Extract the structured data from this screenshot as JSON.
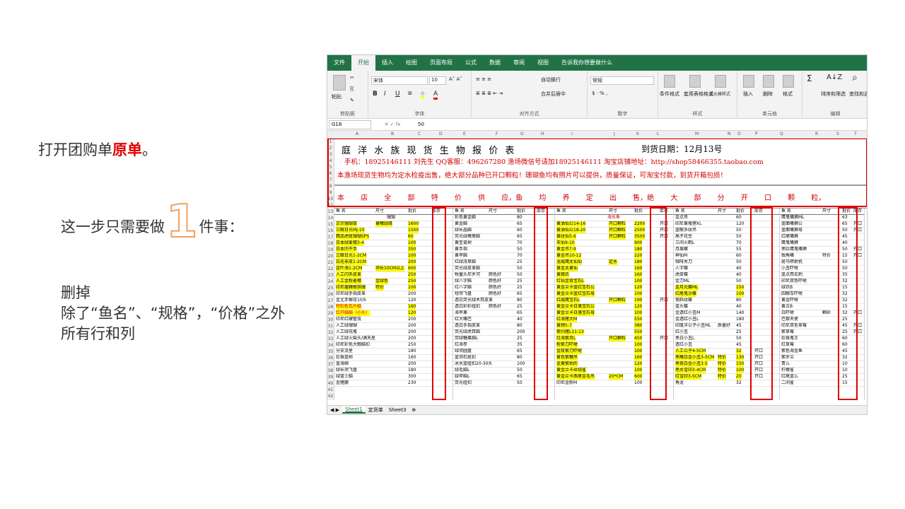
{
  "slide": {
    "step_text_prefix": "打开团购单",
    "step_text_highlight": "原单",
    "step_text_suffix": "。",
    "only_one_prefix": "这一步只需要做",
    "only_one_number": "1",
    "only_one_suffix": "件事：",
    "delete_title": "删掉",
    "delete_line2": "除了“鱼名”、“规格”，“价格”之外",
    "delete_line3": "所有行和列"
  },
  "excel": {
    "tabs": [
      "文件",
      "开始",
      "插入",
      "绘图",
      "页面布局",
      "公式",
      "数据",
      "审阅",
      "视图",
      "告诉我你想要做什么"
    ],
    "active_tab": "开始",
    "clipboard_label": "剪贴板",
    "paste_label": "粘贴",
    "font_label": "字体",
    "font_name": "宋体",
    "font_size": "10",
    "align_label": "对齐方式",
    "wrap_label": "自动换行",
    "merge_label": "合并后居中",
    "number_label": "数字",
    "number_format": "常规",
    "styles_label": "样式",
    "cond_format": "条件格式",
    "table_format": "套用表格格式",
    "cell_style": "单元格样式",
    "cells_label": "单元格",
    "insert": "插入",
    "delete": "删除",
    "format": "格式",
    "edit_label": "编辑",
    "sort_filter": "排序和筛选",
    "find_select": "查找和选",
    "namebox": "G18",
    "fx": "fx",
    "formula_value": "50",
    "columns": [
      "A",
      "B",
      "C",
      "D",
      "E",
      "F",
      "G",
      "H",
      "I",
      "J",
      "K",
      "L",
      "M",
      "N",
      "O",
      "P",
      "Q",
      "R",
      "S",
      "T"
    ],
    "title": "庭 洋 水 族 现 货 生 物 报 价 表",
    "date": "到货日期：12月13号",
    "contact": "手机：18925146111 刘先生      QQ客服：496267280 渔场微信号请加18925146111 淘宝店铺地址：http://shop58466355.taobao.com",
    "notice": "本渔场现货生物均为定水检疫出售，绝大部分品种已开口颗粒！珊瑚鱼均有照片可以提供，质量保证，可淘宝付款，到货开箱包损！",
    "sale_line": "本 店 全 部 特 价 供 应，鱼 均 养 定 出 售，绝 大 部 分 开 口 颗 粒，",
    "header": {
      "name": "鱼 名",
      "size": "尺寸",
      "price": "批价",
      "stock": "库存"
    },
    "sec1_title": "珊瑚",
    "sec2_title": "海水鱼",
    "sheets": [
      "Sheet1",
      "定货单",
      "Sheet3"
    ],
    "block1": [
      [
        "正宗珊瑚苗",
        "黄鳍绿缘",
        "1600"
      ],
      [
        "三眼日光MJ-10",
        "",
        "1500"
      ],
      [
        "精品虎斑珊瑚SPS",
        "",
        "60"
      ],
      [
        "日本绿麦穗3-4",
        "",
        "100"
      ],
      [
        "日本凹干手",
        "",
        "350"
      ],
      [
        "三眼日光1-2CM",
        "",
        "100"
      ],
      [
        "白花非皮1-2CM",
        "",
        "200"
      ],
      [
        "金叶海1-2CM",
        "须长10CM以上",
        "600"
      ],
      [
        "人工闪手皮革",
        "",
        "250"
      ],
      [
        "人工金粉麦穗",
        "金绿色",
        "250"
      ],
      [
        "印尼瘤棘根指珊",
        "特价",
        "100"
      ],
      [
        "印尼绿手指皮革",
        "",
        "200"
      ],
      [
        "金尤手椰花10头",
        "",
        "120"
      ],
      [
        "特别色瓦片脑",
        "",
        "160"
      ],
      [
        "红开脑脑（小头）",
        "",
        "120"
      ],
      [
        "印尼红硬管虫",
        "",
        "200"
      ],
      [
        "人工绿珊瑚",
        "",
        "200"
      ],
      [
        "人工绿花瓶",
        "",
        "200"
      ],
      [
        "人工绿火柴头/满天星",
        "",
        "200"
      ],
      [
        "印尼彩色大眼脑扣",
        "",
        "250"
      ],
      [
        "分支流星",
        "",
        "180"
      ],
      [
        "珍珠蓝树",
        "",
        "160"
      ],
      [
        "蓝海绵",
        "",
        "200"
      ],
      [
        "绿长须飞盘",
        "",
        "180"
      ],
      [
        "绿蓝士脑",
        "",
        "300"
      ],
      [
        "金猪骡",
        "",
        "230"
      ]
    ],
    "block2": [
      [
        "彩色黄金脑",
        "",
        "80"
      ],
      [
        "黄金脑",
        "",
        "65"
      ],
      [
        "绿长晶脑",
        "",
        "60"
      ],
      [
        "荧光绿棒尾脑",
        "",
        "65"
      ],
      [
        "黄圣诞树",
        "",
        "70"
      ],
      [
        "黄手指",
        "",
        "50"
      ],
      [
        "黄苹脑",
        "",
        "70"
      ],
      [
        "红绿茂草脑",
        "",
        "25"
      ],
      [
        "荧光绿皮革脑",
        "",
        "50"
      ],
      [
        "牧童头尼罗河",
        "颜色好",
        "50"
      ],
      [
        "绿八字脑",
        "颜色好",
        "25"
      ],
      [
        "红八字脑",
        "颜色好",
        "25"
      ],
      [
        "短须飞盘",
        "颜色好",
        "65"
      ],
      [
        "透白荧光绿木耳皮革",
        "",
        "80"
      ],
      [
        "透白彩彩纽扣",
        "颜色好",
        "25"
      ],
      [
        "海苹果",
        "",
        "65"
      ],
      [
        "红大嘴巴",
        "",
        "40"
      ],
      [
        "透白手指皮革",
        "",
        "80"
      ],
      [
        "荧光绿虎耳脑",
        "",
        "200"
      ],
      [
        "荧绿糖果脑L",
        "",
        "25"
      ],
      [
        "红海参",
        "",
        "35"
      ],
      [
        "绿须圆盘",
        "",
        "65"
      ],
      [
        "蓝须石斑扣",
        "",
        "80"
      ],
      [
        "冰水蓝纽扣20-30头",
        "",
        "100"
      ],
      [
        "绿毛脑L",
        "",
        "50"
      ],
      [
        "绿苹脑L",
        "",
        "65"
      ],
      [
        "荧光纽扣",
        "",
        "50"
      ]
    ],
    "block3": [
      [
        "黄油仙公14-16",
        "开口颗粒",
        "2200"
      ],
      [
        "黄油仙公18-20",
        "开口颗粒",
        "2500"
      ],
      [
        "黄纹仙5-6",
        "开口颗粒",
        "3500"
      ],
      [
        "天仙9-10",
        "",
        "900"
      ],
      [
        "黄金吊7-9",
        "",
        "180"
      ],
      [
        "黄金吊10-12",
        "",
        "220"
      ],
      [
        "龙威鹰太仙仙",
        "定水",
        "180"
      ],
      [
        "黄金太黄仙",
        "",
        "160"
      ],
      [
        "黄蜡衣",
        "",
        "160"
      ],
      [
        "红钻金背宝石L",
        "",
        "100"
      ],
      [
        "黄金兰卡蓝红宝石公",
        "",
        "120"
      ],
      [
        "黄金兰卡蓝红宝石母",
        "",
        "100"
      ],
      [
        "红威鹰宝石L",
        "开口颗粒",
        "190"
      ],
      [
        "黄金兰卡日落宝石公",
        "",
        "120"
      ],
      [
        "黄金兰卡日落宝石母",
        "",
        "100"
      ],
      [
        "红海猪大M",
        "",
        "550"
      ],
      [
        "黄颊5-7",
        "",
        "380"
      ],
      [
        "紫扫猪L11-13",
        "",
        "550"
      ],
      [
        "红海紫月L",
        "开口颗粒",
        "450"
      ],
      [
        "粉紫刀吓唬",
        "",
        "100"
      ],
      [
        "金玫紫刀吓唬",
        "",
        "100"
      ],
      [
        "黄色紫糖吊",
        "",
        "160"
      ],
      [
        "金黄紫枯的",
        "",
        "120"
      ],
      [
        "黄金兰卡丝绒雀",
        "",
        "100"
      ],
      [
        "黄金兰卡燕尾金毛吊",
        "20*CM",
        "600"
      ],
      [
        "印尼金粉M",
        "",
        "100"
      ]
    ],
    "block4": [
      [
        "金点吊",
        "",
        "60"
      ],
      [
        "印尼黄瓶狸XL",
        "",
        "120"
      ],
      [
        "蓝眼多纹吊",
        "",
        "50"
      ],
      [
        "高子花豆",
        "",
        "50"
      ],
      [
        "三间火鹤L",
        "",
        "70"
      ],
      [
        "月眉螺",
        "",
        "55"
      ],
      [
        "神仙M",
        "",
        "60"
      ],
      [
        "咖啡关刀",
        "",
        "50"
      ],
      [
        "人字蝶",
        "",
        "40"
      ],
      [
        "虎皮蝶",
        "",
        "40"
      ],
      [
        "金刀ML",
        "",
        "50"
      ],
      [
        "金月光蝶ML",
        "",
        "150"
      ],
      [
        "红尾鬼沙蝶",
        "",
        "100"
      ],
      [
        "锡斜纹蝶",
        "",
        "80"
      ],
      [
        "蓝头蝶",
        "",
        "40"
      ],
      [
        "金透红小丑M",
        "",
        "140"
      ],
      [
        "金透红小丑L",
        "",
        "180"
      ],
      [
        "印度洋公子小丑ML",
        "质量好",
        "45"
      ],
      [
        "红小丑",
        "",
        "25"
      ],
      [
        "黑白小丑L",
        "",
        "50"
      ],
      [
        "透红小丑",
        "",
        "45"
      ],
      [
        "人工公子4-5CM",
        "",
        "32"
      ],
      [
        "黑鳍白金小丑3-5CM",
        "特价",
        "130"
      ],
      [
        "黑夜白金小丑3-5",
        "特价",
        "150"
      ],
      [
        "黑水雪印3-4CM",
        "特价",
        "100"
      ],
      [
        "红雪印3-5CM",
        "特价",
        "20"
      ],
      [
        "角龙",
        "",
        "32"
      ]
    ],
    "block5": [
      [
        "鹰鬼嘴狮ML",
        "",
        "63"
      ],
      [
        "蓝面嘴狮公",
        "",
        "65"
      ],
      [
        "蓝面嘴狮母",
        "",
        "50"
      ],
      [
        "红尾嘴狮",
        "",
        "45"
      ],
      [
        "鹰鬼嘴狮",
        "",
        "40"
      ],
      [
        "黑肚鹰鬼嘴狮",
        "",
        "50"
      ],
      [
        "独角嘴",
        "特价",
        "15"
      ],
      [
        "斑马喷射机",
        "",
        "50"
      ],
      [
        "小丑吓唬",
        "",
        "50"
      ],
      [
        "蓝点西瓜刺",
        "",
        "35"
      ],
      [
        "印尼双色吓唬",
        "",
        "32"
      ],
      [
        "绿衣B",
        "",
        "15"
      ],
      [
        "四眼车吓唬",
        "",
        "32"
      ],
      [
        "黄金吓唬",
        "",
        "32"
      ],
      [
        "黄古B",
        "",
        "15"
      ],
      [
        "白吓唬",
        "颗砂",
        "32"
      ],
      [
        "巴黎天使",
        "",
        "25"
      ],
      [
        "印尼双色草莓",
        "",
        "45"
      ],
      [
        "紫草莓",
        "",
        "25"
      ],
      [
        "珍珠鬼王",
        "",
        "60"
      ],
      [
        "红草莓",
        "",
        "60"
      ],
      [
        "紫色海金鱼",
        "",
        "45"
      ],
      [
        "紫罗兰",
        "",
        "32"
      ],
      [
        "青么",
        "",
        "10"
      ],
      [
        "柠檬雀",
        "",
        "10"
      ],
      [
        "红尾蓝么",
        "",
        "25"
      ],
      [
        "二间雀",
        "",
        "15"
      ]
    ]
  }
}
